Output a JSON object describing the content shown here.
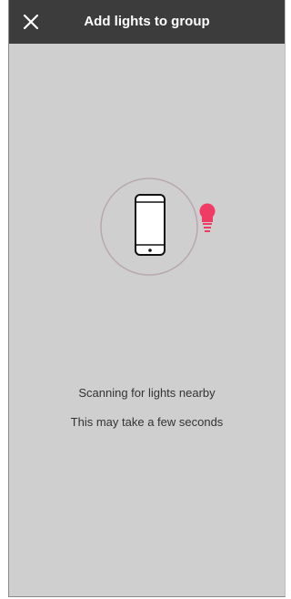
{
  "header": {
    "title": "Add lights to group",
    "close_icon": "close-icon"
  },
  "illustration": {
    "phone_icon": "smartphone-icon",
    "bulb_icon": "lightbulb-icon",
    "accent_color": "#f03c64"
  },
  "status": {
    "scanning": "Scanning for lights nearby",
    "hint": "This may take a few seconds"
  }
}
